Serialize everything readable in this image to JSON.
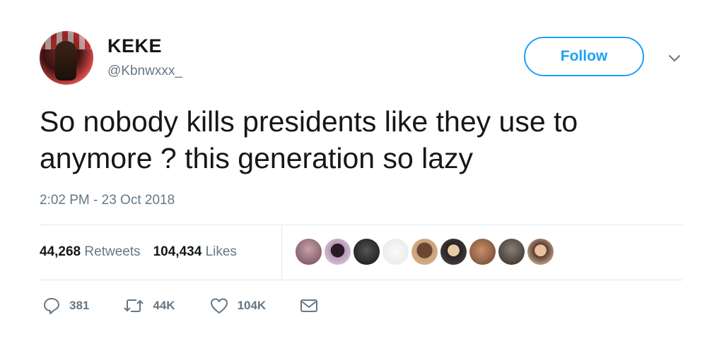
{
  "user": {
    "name": "KEKE",
    "handle": "@Kbnwxxx_",
    "follow_label": "Follow"
  },
  "tweet": {
    "text": "So nobody kills presidents like they use to anymore ? this generation so lazy",
    "timestamp": "2:02 PM - 23 Oct 2018"
  },
  "stats": {
    "retweets_count": "44,268",
    "retweets_label": "Retweets",
    "likes_count": "104,434",
    "likes_label": "Likes"
  },
  "actions": {
    "replies": "381",
    "retweets": "44K",
    "likes": "104K"
  },
  "colors": {
    "accent": "#1da1f2",
    "muted": "#657786",
    "text": "#14171a"
  },
  "icons": [
    "chevron-down-icon",
    "reply-icon",
    "retweet-icon",
    "heart-icon",
    "mail-icon"
  ]
}
